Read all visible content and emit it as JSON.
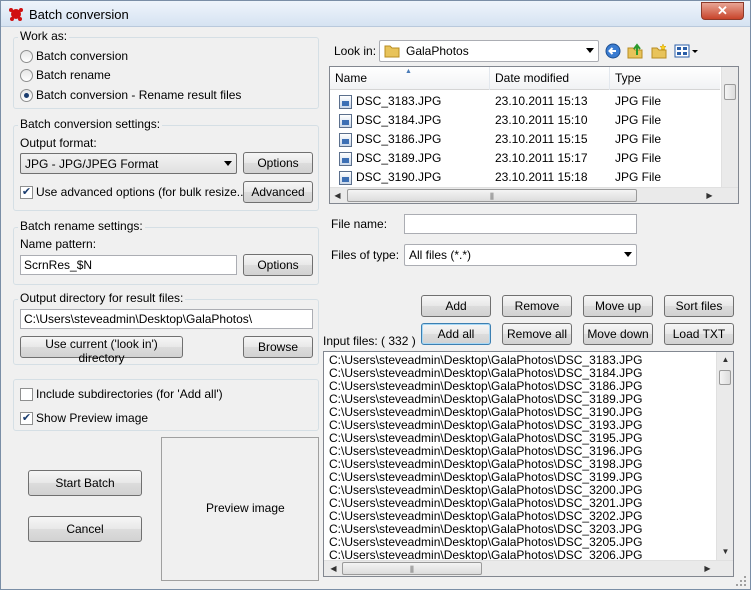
{
  "window": {
    "title": "Batch conversion",
    "close_label": "✕"
  },
  "work_as": {
    "group_label": "Work as:",
    "options": [
      {
        "label": "Batch conversion",
        "checked": false
      },
      {
        "label": "Batch rename",
        "checked": false
      },
      {
        "label": "Batch conversion - Rename result files",
        "checked": true
      }
    ]
  },
  "conversion": {
    "group_label": "Batch conversion settings:",
    "output_format_label": "Output format:",
    "output_format_value": "JPG - JPG/JPEG Format",
    "options_button": "Options",
    "advanced_checkbox_label": "Use advanced options (for bulk resize...)",
    "advanced_checked": true,
    "advanced_button": "Advanced"
  },
  "rename": {
    "group_label": "Batch rename settings:",
    "name_pattern_label": "Name pattern:",
    "name_pattern_value": "ScrnRes_$N",
    "options_button": "Options"
  },
  "output_dir": {
    "group_label": "Output directory for result files:",
    "path": "C:\\Users\\steveadmin\\Desktop\\GalaPhotos\\",
    "use_current_button": "Use current ('look in') directory",
    "browse_button": "Browse"
  },
  "flags": {
    "include_subdirs_label": "Include subdirectories (for 'Add all')",
    "include_subdirs_checked": false,
    "show_preview_label": "Show Preview image",
    "show_preview_checked": true
  },
  "actions": {
    "start_batch": "Start Batch",
    "cancel": "Cancel"
  },
  "preview": {
    "label": "Preview image"
  },
  "browser": {
    "look_in_label": "Look in:",
    "look_in_value": "GalaPhotos",
    "columns": [
      "Name",
      "Date modified",
      "Type"
    ],
    "files": [
      {
        "name": "DSC_3183.JPG",
        "date": "23.10.2011 15:13",
        "type": "JPG File"
      },
      {
        "name": "DSC_3184.JPG",
        "date": "23.10.2011 15:10",
        "type": "JPG File"
      },
      {
        "name": "DSC_3186.JPG",
        "date": "23.10.2011 15:15",
        "type": "JPG File"
      },
      {
        "name": "DSC_3189.JPG",
        "date": "23.10.2011 15:17",
        "type": "JPG File"
      },
      {
        "name": "DSC_3190.JPG",
        "date": "23.10.2011 15:18",
        "type": "JPG File"
      }
    ],
    "file_name_label": "File name:",
    "file_name_value": "",
    "files_of_type_label": "Files of type:",
    "files_of_type_value": "All files (*.*)"
  },
  "list_buttons": {
    "add": "Add",
    "remove": "Remove",
    "move_up": "Move up",
    "sort_files": "Sort files",
    "add_all": "Add all",
    "remove_all": "Remove all",
    "move_down": "Move down",
    "load_txt": "Load TXT"
  },
  "input_files": {
    "label": "Input files: ( 332 )",
    "items": [
      "C:\\Users\\steveadmin\\Desktop\\GalaPhotos\\DSC_3183.JPG",
      "C:\\Users\\steveadmin\\Desktop\\GalaPhotos\\DSC_3184.JPG",
      "C:\\Users\\steveadmin\\Desktop\\GalaPhotos\\DSC_3186.JPG",
      "C:\\Users\\steveadmin\\Desktop\\GalaPhotos\\DSC_3189.JPG",
      "C:\\Users\\steveadmin\\Desktop\\GalaPhotos\\DSC_3190.JPG",
      "C:\\Users\\steveadmin\\Desktop\\GalaPhotos\\DSC_3193.JPG",
      "C:\\Users\\steveadmin\\Desktop\\GalaPhotos\\DSC_3195.JPG",
      "C:\\Users\\steveadmin\\Desktop\\GalaPhotos\\DSC_3196.JPG",
      "C:\\Users\\steveadmin\\Desktop\\GalaPhotos\\DSC_3198.JPG",
      "C:\\Users\\steveadmin\\Desktop\\GalaPhotos\\DSC_3199.JPG",
      "C:\\Users\\steveadmin\\Desktop\\GalaPhotos\\DSC_3200.JPG",
      "C:\\Users\\steveadmin\\Desktop\\GalaPhotos\\DSC_3201.JPG",
      "C:\\Users\\steveadmin\\Desktop\\GalaPhotos\\DSC_3202.JPG",
      "C:\\Users\\steveadmin\\Desktop\\GalaPhotos\\DSC_3203.JPG",
      "C:\\Users\\steveadmin\\Desktop\\GalaPhotos\\DSC_3205.JPG",
      "C:\\Users\\steveadmin\\Desktop\\GalaPhotos\\DSC_3206.JPG"
    ]
  }
}
